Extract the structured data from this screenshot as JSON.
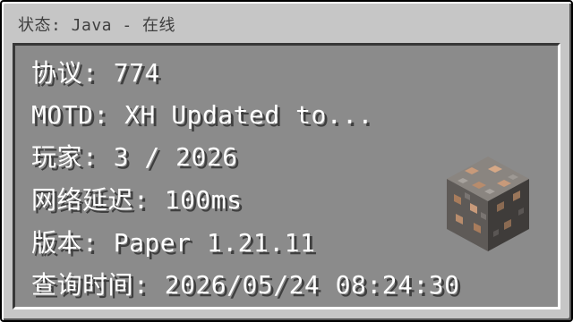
{
  "window": {
    "title": "状态: Java - 在线"
  },
  "rows": [
    {
      "label": "协议:",
      "value": "774"
    },
    {
      "label": "MOTD:",
      "value": "XH Updated to..."
    },
    {
      "label": "玩家:",
      "value": "3 / 2026"
    },
    {
      "label": "网络延迟:",
      "value": "100ms"
    },
    {
      "label": "版本:",
      "value": "Paper 1.21.11"
    },
    {
      "label": "查询时间:",
      "value": "2026/05/24 08:24:30"
    }
  ],
  "icon": {
    "name": "iron-ore-block-icon"
  },
  "colors": {
    "window_bg": "#c6c6c6",
    "panel_bg": "#8b8b8b",
    "text": "#ffffff",
    "title_text": "#3f3f3f"
  }
}
